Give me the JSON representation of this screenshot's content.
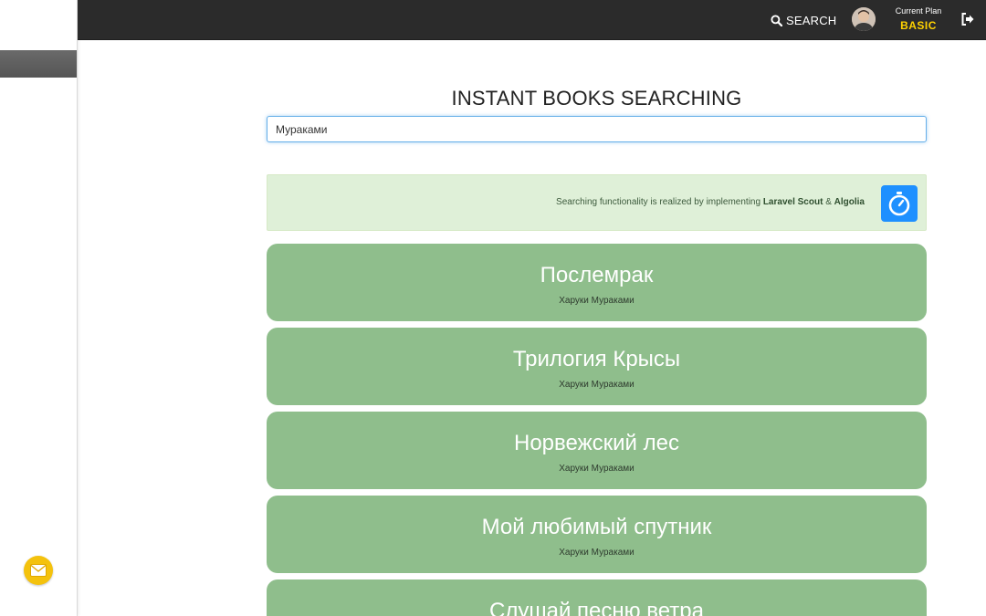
{
  "topbar": {
    "search_label": "SEARCH",
    "plan_label": "Current Plan",
    "plan_value": "BASIC"
  },
  "main": {
    "title": "INSTANT BOOKS SEARCHING",
    "search_value": "Мураками",
    "info": {
      "prefix": "Searching functionality is realized by implementing ",
      "tech1": "Laravel Scout",
      "amp": " & ",
      "tech2": "Algolia"
    }
  },
  "results": [
    {
      "title": "Послемрак",
      "author": "Харуки Мураками"
    },
    {
      "title": "Трилогия Крысы",
      "author": "Харуки Мураками"
    },
    {
      "title": "Норвежский лес",
      "author": "Харуки Мураками"
    },
    {
      "title": "Мой любимый спутник",
      "author": "Харуки Мураками"
    },
    {
      "title": "Слушай песню ветра",
      "author": ""
    }
  ],
  "colors": {
    "topbar": "#2b2b2b",
    "card": "#8fbe8c",
    "plan_accent": "#ffd200",
    "info_bg": "#dff0d8",
    "algolia_blue": "#1e90ff",
    "mail_button": "#f4c20d"
  },
  "icons": {
    "search": "search-icon",
    "avatar": "avatar",
    "logout": "logout-icon",
    "algolia": "algolia-stopwatch-icon",
    "mail": "envelope-icon"
  }
}
